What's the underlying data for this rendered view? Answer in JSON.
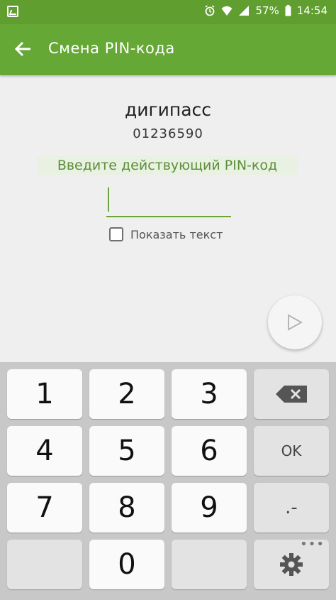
{
  "status_bar": {
    "battery": "57%",
    "time": "14:54"
  },
  "app_bar": {
    "title": "Смена PIN-кода"
  },
  "token": {
    "name": "дигипасс",
    "serial": "01236590"
  },
  "pin_form": {
    "prompt": "Введите действующий PIN-код",
    "pin_value": "",
    "show_text_label": "Показать текст"
  },
  "keyboard": {
    "keys": [
      "1",
      "2",
      "3",
      "4",
      "5",
      "6",
      "7",
      "8",
      "9",
      "0"
    ],
    "ok_label": "OK",
    "punct_label": ".-",
    "more_dots": "•••"
  },
  "colors": {
    "status_bar": "#5f9e2f",
    "app_bar": "#66a836",
    "accent": "#6aa43a",
    "prompt_text": "#5b8f38"
  }
}
